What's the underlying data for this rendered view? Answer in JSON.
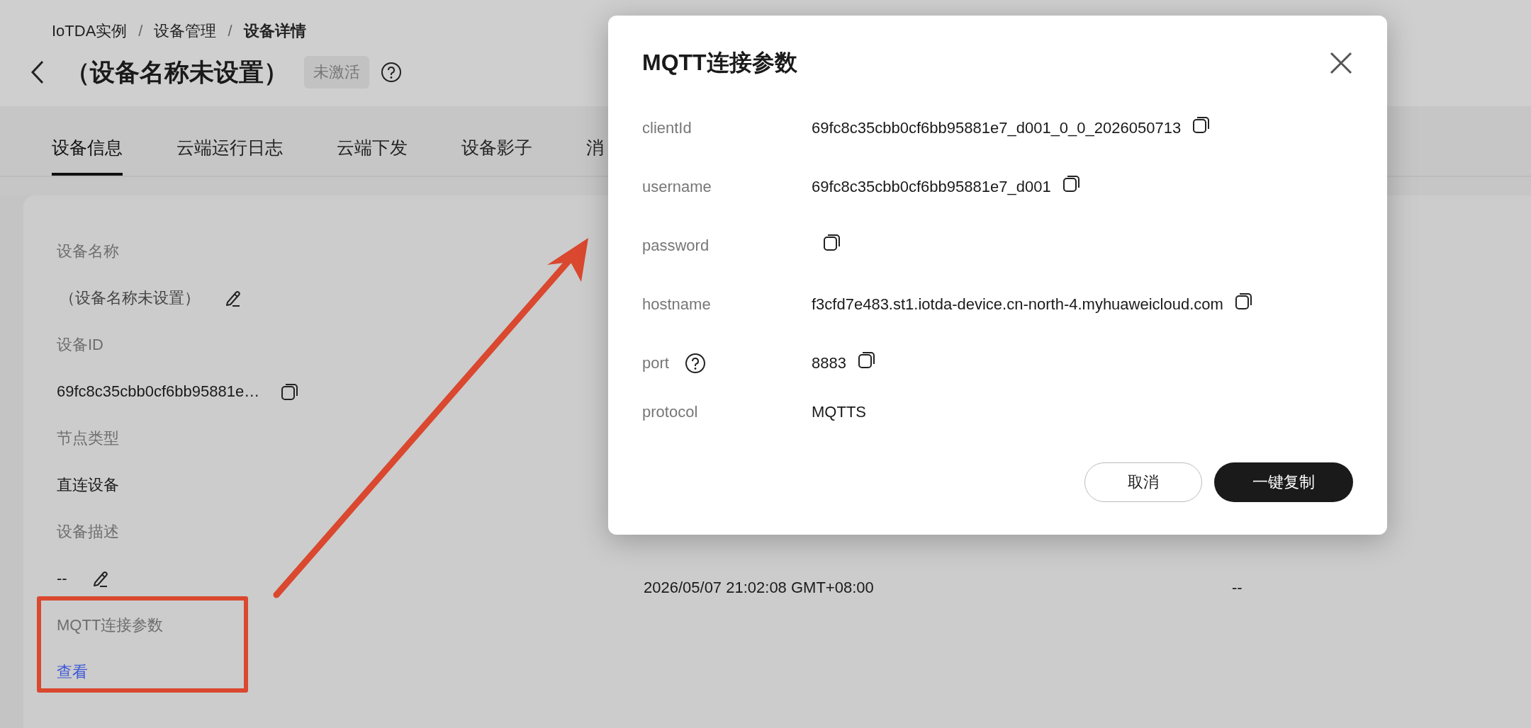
{
  "breadcrumb": [
    {
      "label": "IoTDA实例",
      "current": false
    },
    {
      "separator": "/",
      "label": "设备管理",
      "current": false
    },
    {
      "separator": "/",
      "label": "设备详情",
      "current": true
    }
  ],
  "page_title": "（设备名称未设置）",
  "status_badge": "未激活",
  "tabs": [
    {
      "label": "设备信息",
      "selected": true
    },
    {
      "label": "云端运行日志",
      "selected": false
    },
    {
      "label": "云端下发",
      "selected": false
    },
    {
      "label": "设备影子",
      "selected": false
    },
    {
      "label": "消",
      "selected": false
    }
  ],
  "fields": [
    {
      "label": "设备名称",
      "value": "（设备名称未设置）",
      "kind": "editable"
    },
    {
      "label": "设备ID",
      "value": "69fc8c35cbb0cf6bb95881e…",
      "kind": "copyable"
    },
    {
      "label": "节点类型",
      "value": "直连设备",
      "kind": "plain"
    },
    {
      "label": "设备描述",
      "value": "--",
      "kind": "editable"
    },
    {
      "label": "MQTT连接参数",
      "value": "查看",
      "kind": "link"
    }
  ],
  "other_columns": [
    {
      "value": "2026/05/07 21:02:08 GMT+08:00"
    },
    {
      "value": "--"
    }
  ],
  "dialog": {
    "title": "MQTT连接参数",
    "params": [
      {
        "name": "clientId",
        "value": "69fc8c35cbb0cf6bb95881e7_d001_0_0_2026050713",
        "kind": "copy"
      },
      {
        "name": "username",
        "value": "69fc8c35cbb0cf6bb95881e7_d001",
        "kind": "copy"
      },
      {
        "name": "password",
        "kind": "copy"
      },
      {
        "name": "hostname",
        "value": "f3cfd7e483.st1.iotda-device.cn-north-4.myhuaweicloud.com",
        "kind": "copy"
      },
      {
        "name": "port",
        "value": "8883",
        "kind": "copy_help"
      },
      {
        "name": "protocol",
        "value": "MQTTS",
        "kind": "plain"
      }
    ],
    "buttons": [
      {
        "label": "取消",
        "kind": "secondary"
      },
      {
        "label": "一键复制",
        "kind": "primary"
      }
    ]
  }
}
